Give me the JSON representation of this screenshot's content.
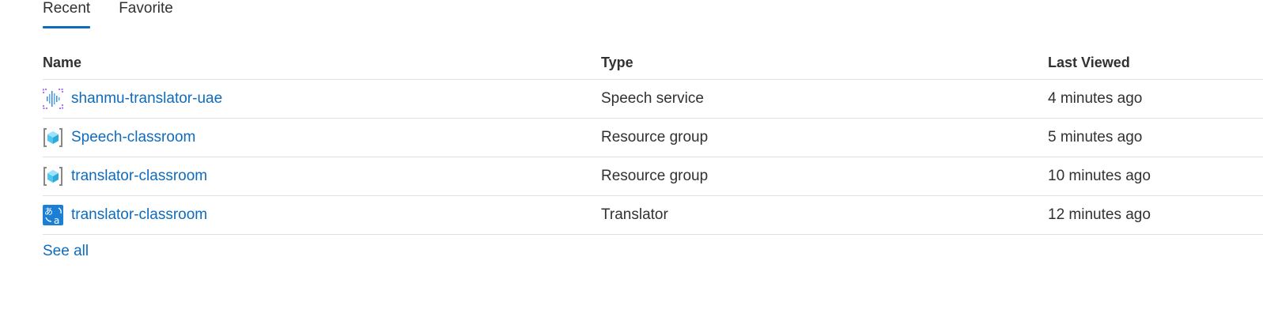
{
  "tabs": [
    {
      "label": "Recent",
      "active": true
    },
    {
      "label": "Favorite",
      "active": false
    }
  ],
  "columns": {
    "name": "Name",
    "type": "Type",
    "last_viewed": "Last Viewed"
  },
  "rows": [
    {
      "name": "shanmu-translator-uae",
      "type": "Speech service",
      "last_viewed": "4 minutes ago",
      "icon": "speech-service-icon"
    },
    {
      "name": "Speech-classroom",
      "type": "Resource group",
      "last_viewed": "5 minutes ago",
      "icon": "resource-group-icon"
    },
    {
      "name": "translator-classroom",
      "type": "Resource group",
      "last_viewed": "10 minutes ago",
      "icon": "resource-group-icon"
    },
    {
      "name": "translator-classroom",
      "type": "Translator",
      "last_viewed": "12 minutes ago",
      "icon": "translator-icon"
    }
  ],
  "footer": {
    "see_all": "See all"
  },
  "colors": {
    "link": "#0f6cbd",
    "text": "#323130",
    "divider": "#e1dfdd"
  }
}
